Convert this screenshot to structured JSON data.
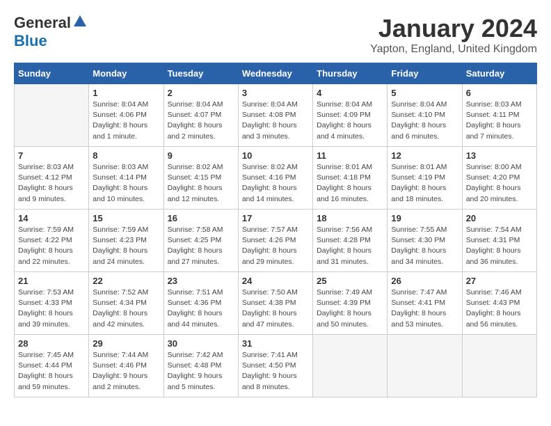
{
  "logo": {
    "general": "General",
    "blue": "Blue"
  },
  "title": "January 2024",
  "location": "Yapton, England, United Kingdom",
  "days_of_week": [
    "Sunday",
    "Monday",
    "Tuesday",
    "Wednesday",
    "Thursday",
    "Friday",
    "Saturday"
  ],
  "weeks": [
    [
      {
        "num": "",
        "info": ""
      },
      {
        "num": "1",
        "info": "Sunrise: 8:04 AM\nSunset: 4:06 PM\nDaylight: 8 hours\nand 1 minute."
      },
      {
        "num": "2",
        "info": "Sunrise: 8:04 AM\nSunset: 4:07 PM\nDaylight: 8 hours\nand 2 minutes."
      },
      {
        "num": "3",
        "info": "Sunrise: 8:04 AM\nSunset: 4:08 PM\nDaylight: 8 hours\nand 3 minutes."
      },
      {
        "num": "4",
        "info": "Sunrise: 8:04 AM\nSunset: 4:09 PM\nDaylight: 8 hours\nand 4 minutes."
      },
      {
        "num": "5",
        "info": "Sunrise: 8:04 AM\nSunset: 4:10 PM\nDaylight: 8 hours\nand 6 minutes."
      },
      {
        "num": "6",
        "info": "Sunrise: 8:03 AM\nSunset: 4:11 PM\nDaylight: 8 hours\nand 7 minutes."
      }
    ],
    [
      {
        "num": "7",
        "info": "Sunrise: 8:03 AM\nSunset: 4:12 PM\nDaylight: 8 hours\nand 9 minutes."
      },
      {
        "num": "8",
        "info": "Sunrise: 8:03 AM\nSunset: 4:14 PM\nDaylight: 8 hours\nand 10 minutes."
      },
      {
        "num": "9",
        "info": "Sunrise: 8:02 AM\nSunset: 4:15 PM\nDaylight: 8 hours\nand 12 minutes."
      },
      {
        "num": "10",
        "info": "Sunrise: 8:02 AM\nSunset: 4:16 PM\nDaylight: 8 hours\nand 14 minutes."
      },
      {
        "num": "11",
        "info": "Sunrise: 8:01 AM\nSunset: 4:18 PM\nDaylight: 8 hours\nand 16 minutes."
      },
      {
        "num": "12",
        "info": "Sunrise: 8:01 AM\nSunset: 4:19 PM\nDaylight: 8 hours\nand 18 minutes."
      },
      {
        "num": "13",
        "info": "Sunrise: 8:00 AM\nSunset: 4:20 PM\nDaylight: 8 hours\nand 20 minutes."
      }
    ],
    [
      {
        "num": "14",
        "info": "Sunrise: 7:59 AM\nSunset: 4:22 PM\nDaylight: 8 hours\nand 22 minutes."
      },
      {
        "num": "15",
        "info": "Sunrise: 7:59 AM\nSunset: 4:23 PM\nDaylight: 8 hours\nand 24 minutes."
      },
      {
        "num": "16",
        "info": "Sunrise: 7:58 AM\nSunset: 4:25 PM\nDaylight: 8 hours\nand 27 minutes."
      },
      {
        "num": "17",
        "info": "Sunrise: 7:57 AM\nSunset: 4:26 PM\nDaylight: 8 hours\nand 29 minutes."
      },
      {
        "num": "18",
        "info": "Sunrise: 7:56 AM\nSunset: 4:28 PM\nDaylight: 8 hours\nand 31 minutes."
      },
      {
        "num": "19",
        "info": "Sunrise: 7:55 AM\nSunset: 4:30 PM\nDaylight: 8 hours\nand 34 minutes."
      },
      {
        "num": "20",
        "info": "Sunrise: 7:54 AM\nSunset: 4:31 PM\nDaylight: 8 hours\nand 36 minutes."
      }
    ],
    [
      {
        "num": "21",
        "info": "Sunrise: 7:53 AM\nSunset: 4:33 PM\nDaylight: 8 hours\nand 39 minutes."
      },
      {
        "num": "22",
        "info": "Sunrise: 7:52 AM\nSunset: 4:34 PM\nDaylight: 8 hours\nand 42 minutes."
      },
      {
        "num": "23",
        "info": "Sunrise: 7:51 AM\nSunset: 4:36 PM\nDaylight: 8 hours\nand 44 minutes."
      },
      {
        "num": "24",
        "info": "Sunrise: 7:50 AM\nSunset: 4:38 PM\nDaylight: 8 hours\nand 47 minutes."
      },
      {
        "num": "25",
        "info": "Sunrise: 7:49 AM\nSunset: 4:39 PM\nDaylight: 8 hours\nand 50 minutes."
      },
      {
        "num": "26",
        "info": "Sunrise: 7:47 AM\nSunset: 4:41 PM\nDaylight: 8 hours\nand 53 minutes."
      },
      {
        "num": "27",
        "info": "Sunrise: 7:46 AM\nSunset: 4:43 PM\nDaylight: 8 hours\nand 56 minutes."
      }
    ],
    [
      {
        "num": "28",
        "info": "Sunrise: 7:45 AM\nSunset: 4:44 PM\nDaylight: 8 hours\nand 59 minutes."
      },
      {
        "num": "29",
        "info": "Sunrise: 7:44 AM\nSunset: 4:46 PM\nDaylight: 9 hours\nand 2 minutes."
      },
      {
        "num": "30",
        "info": "Sunrise: 7:42 AM\nSunset: 4:48 PM\nDaylight: 9 hours\nand 5 minutes."
      },
      {
        "num": "31",
        "info": "Sunrise: 7:41 AM\nSunset: 4:50 PM\nDaylight: 9 hours\nand 8 minutes."
      },
      {
        "num": "",
        "info": ""
      },
      {
        "num": "",
        "info": ""
      },
      {
        "num": "",
        "info": ""
      }
    ]
  ]
}
